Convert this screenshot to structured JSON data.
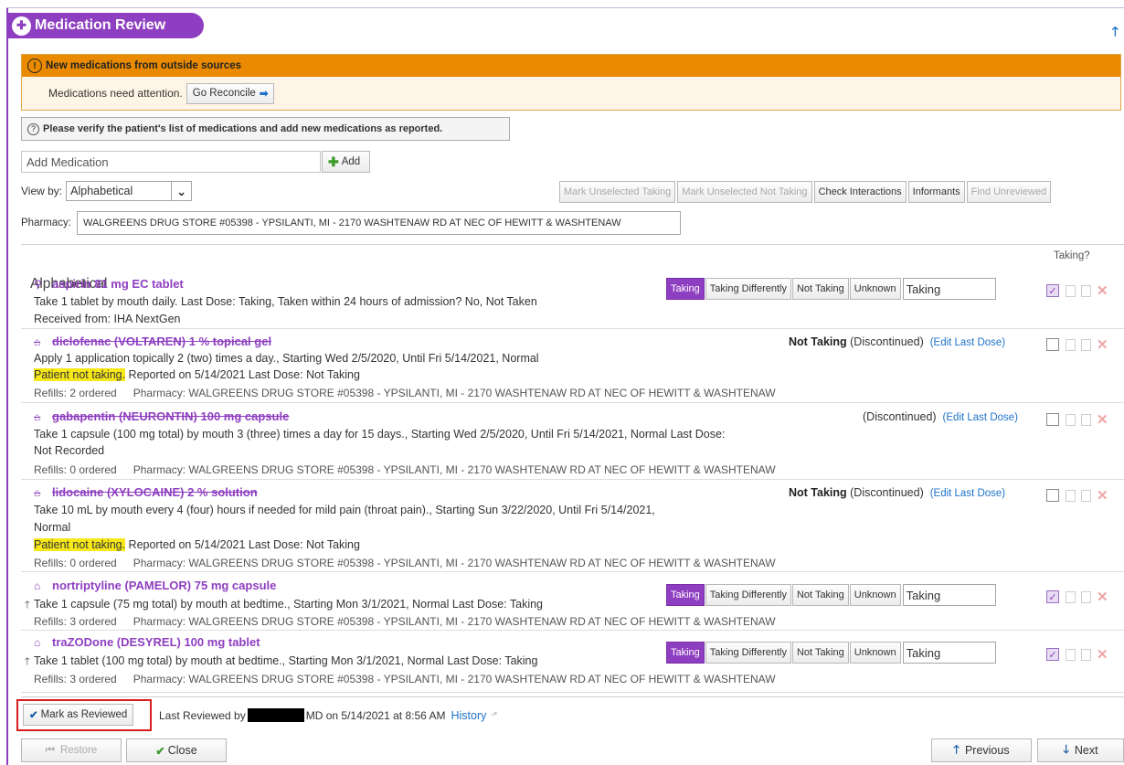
{
  "header": {
    "title": "Medication Review"
  },
  "alert": {
    "title": "New medications from outside sources",
    "message": "Medications need attention.",
    "go_button": "Go Reconcile"
  },
  "verify_text": "Please verify the patient's list of medications and add new medications as reported.",
  "add_medication": {
    "placeholder": "Add Medication",
    "button": "Add"
  },
  "view_by": {
    "label": "View by:",
    "value": "Alphabetical"
  },
  "toolbar": {
    "mark_unselected_taking": "Mark Unselected Taking",
    "mark_unselected_not_taking": "Mark Unselected Not Taking",
    "check_interactions": "Check Interactions",
    "informants": "Informants",
    "find_unreviewed": "Find Unreviewed"
  },
  "pharmacy": {
    "label": "Pharmacy:",
    "value": "WALGREENS DRUG STORE #05398 - YPSILANTI, MI - 2170 WASHTENAW RD AT NEC OF HEWITT & WASHTENAW"
  },
  "list": {
    "title": "Alphabetical",
    "taking_header": "Taking?"
  },
  "status_labels": {
    "taking": "Taking",
    "taking_differently": "Taking Differently",
    "not_taking": "Not Taking",
    "unknown": "Unknown",
    "selected": "Taking",
    "discontinued": "(Discontinued)",
    "edit_last_dose": "(Edit Last Dose)",
    "not_taking_bold": "Not Taking"
  },
  "meds": [
    {
      "name": "aspirin 81 mg EC tablet",
      "line1": "Take 1 tablet by mouth daily. Last Dose: Taking, Taken within 24 hours of admission? No, Not Taken",
      "line2": "Received from: IHA NextGen"
    },
    {
      "name": "diclofenac (VOLTAREN) 1 % topical gel",
      "line1": "Apply 1 application topically 2 (two) times a day., Starting Wed 2/5/2020, Until Fri 5/14/2021, Normal",
      "highlight": "Patient not taking.",
      "line2_rest": " Reported on 5/14/2021 Last Dose: Not Taking",
      "refills": "Refills: 2 ordered",
      "pharmacy": "Pharmacy: WALGREENS DRUG STORE #05398 - YPSILANTI, MI - 2170 WASHTENAW RD AT NEC OF HEWITT & WASHTENAW"
    },
    {
      "name": "gabapentin (NEURONTIN) 100 mg capsule",
      "line1": "Take 1 capsule (100 mg total) by mouth 3 (three) times a day for 15 days., Starting Wed 2/5/2020, Until Fri 5/14/2021, Normal Last Dose:",
      "line2": "Not Recorded",
      "refills": "Refills: 0 ordered",
      "pharmacy": "Pharmacy: WALGREENS DRUG STORE #05398 - YPSILANTI, MI - 2170 WASHTENAW RD AT NEC OF HEWITT & WASHTENAW"
    },
    {
      "name": "lidocaine (XYLOCAINE) 2 % solution",
      "line1": "Take 10 mL by mouth every 4 (four) hours if needed for mild pain (throat pain)., Starting Sun 3/22/2020, Until Fri 5/14/2021,",
      "line2": "Normal",
      "highlight": "Patient not taking.",
      "line3_rest": " Reported on 5/14/2021 Last Dose: Not Taking",
      "refills": "Refills: 0 ordered",
      "pharmacy": "Pharmacy: WALGREENS DRUG STORE #05398 - YPSILANTI, MI - 2170 WASHTENAW RD AT NEC OF HEWITT & WASHTENAW"
    },
    {
      "name": "nortriptyline (PAMELOR) 75 mg capsule",
      "line1": "Take 1 capsule (75 mg total) by mouth at bedtime., Starting Mon 3/1/2021, Normal Last Dose: Taking",
      "refills": "Refills: 3 ordered",
      "pharmacy": "Pharmacy: WALGREENS DRUG STORE #05398 - YPSILANTI, MI - 2170 WASHTENAW RD AT NEC OF HEWITT & WASHTENAW"
    },
    {
      "name": "traZODone (DESYREL) 100 mg tablet",
      "line1": "Take 1 tablet (100 mg total) by mouth at bedtime., Starting Mon 3/1/2021, Normal Last Dose: Taking",
      "refills": "Refills: 3 ordered",
      "pharmacy": "Pharmacy: WALGREENS DRUG STORE #05398 - YPSILANTI, MI - 2170 WASHTENAW RD AT NEC OF HEWITT & WASHTENAW"
    }
  ],
  "footer": {
    "mark_reviewed": "Mark as Reviewed",
    "last_reviewed_prefix": "Last Reviewed by",
    "last_reviewed_suffix": "MD on 5/14/2021 at 8:56 AM",
    "history": "History",
    "restore": "Restore",
    "close": "Close",
    "previous": "Previous",
    "next": "Next"
  },
  "colors": {
    "accent": "#8e3ec0",
    "alert": "#e98a00",
    "link": "#1e73c8",
    "highlight": "#f7e81a",
    "outline": "#d91d1d"
  }
}
